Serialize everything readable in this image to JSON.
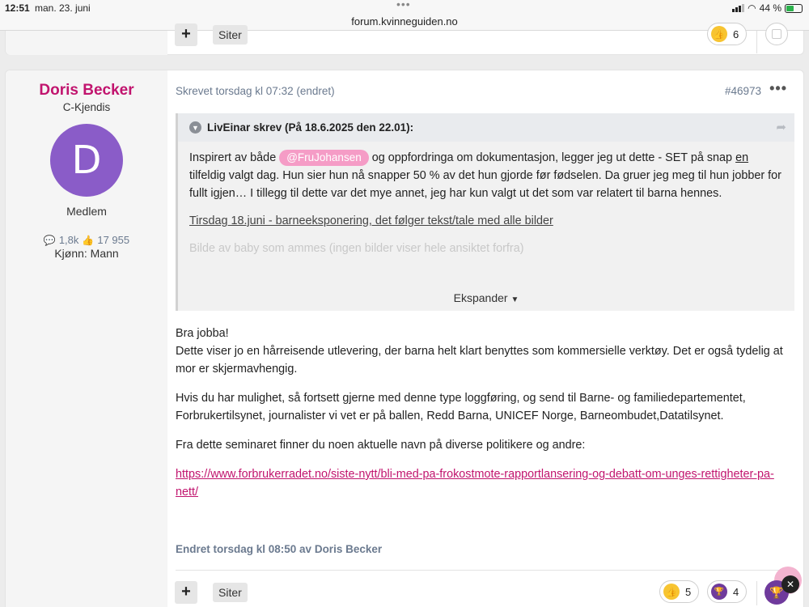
{
  "status_bar": {
    "time": "12:51",
    "date": "man. 23. juni",
    "url": "forum.kvinneguiden.no",
    "battery": "44 %"
  },
  "prev_post": {
    "plus_label": "+",
    "quote_button": "Siter",
    "like_count": "6"
  },
  "author": {
    "name": "Doris Becker",
    "title": "C-Kjendis",
    "avatar_letter": "D",
    "role": "Medlem",
    "posts": "1,8k",
    "likes": "17 955",
    "gender": "Kjønn: Mann"
  },
  "post": {
    "meta": "Skrevet torsdag kl 07:32 (endret)",
    "number": "#46973",
    "quote": {
      "header": "LivEinar skrev (På 18.6.2025 den 22.01):",
      "line1_a": "Inspirert av både",
      "mention": "@FruJohansen",
      "line1_b": "og oppfordringa om dokumentasjon, legger jeg ut dette - SET på",
      "line2_a": "snap",
      "line2_en": "en",
      "line2_b": "tilfeldig valgt dag. Hun sier hun nå snapper 50 % av det hun gjorde før fødselen. Da gruer jeg meg til hun jobber for fullt igjen… I tillegg til dette var det mye annet, jeg har kun valgt ut det som var relatert til barna hennes.",
      "para2": "Tirsdag 18.juni - barneeksponering, det følger tekst/tale med alle bilder",
      "para3": "Bilde av baby som ammes (ingen bilder viser hele ansiktet forfra)",
      "expand": "Ekspander"
    },
    "body": [
      "Bra jobba!",
      "Dette viser jo en hårreisende utlevering, der barna helt klart benyttes som kommersielle verktøy. Det er også tydelig at mor er skjermavhengig.",
      "Hvis du har mulighet, så fortsett gjerne med denne type loggføring, og send til Barne- og familiedepartementet, Forbrukertilsynet, journalister vi vet er på ballen, Redd Barna, UNICEF Norge, Barneombudet,Datatilsynet.",
      "Fra dette seminaret finner du noen aktuelle navn på diverse politikere og andre:"
    ],
    "link": "https://www.forbrukerradet.no/siste-nytt/bli-med-pa-frokostmote-rapportlansering-og-debatt-om-unges-rettigheter-pa-nett/",
    "edited": "Endret torsdag kl 08:50 av Doris Becker",
    "plus_label": "+",
    "quote_button": "Siter",
    "like_count": "5",
    "trophy_count": "4"
  },
  "icons": [
    "signal-icon",
    "wifi-icon",
    "battery-icon",
    "chevron-icon",
    "share-icon",
    "comment-icon",
    "thumbs-up-icon",
    "trophy-icon",
    "close-icon",
    "more-icon"
  ]
}
